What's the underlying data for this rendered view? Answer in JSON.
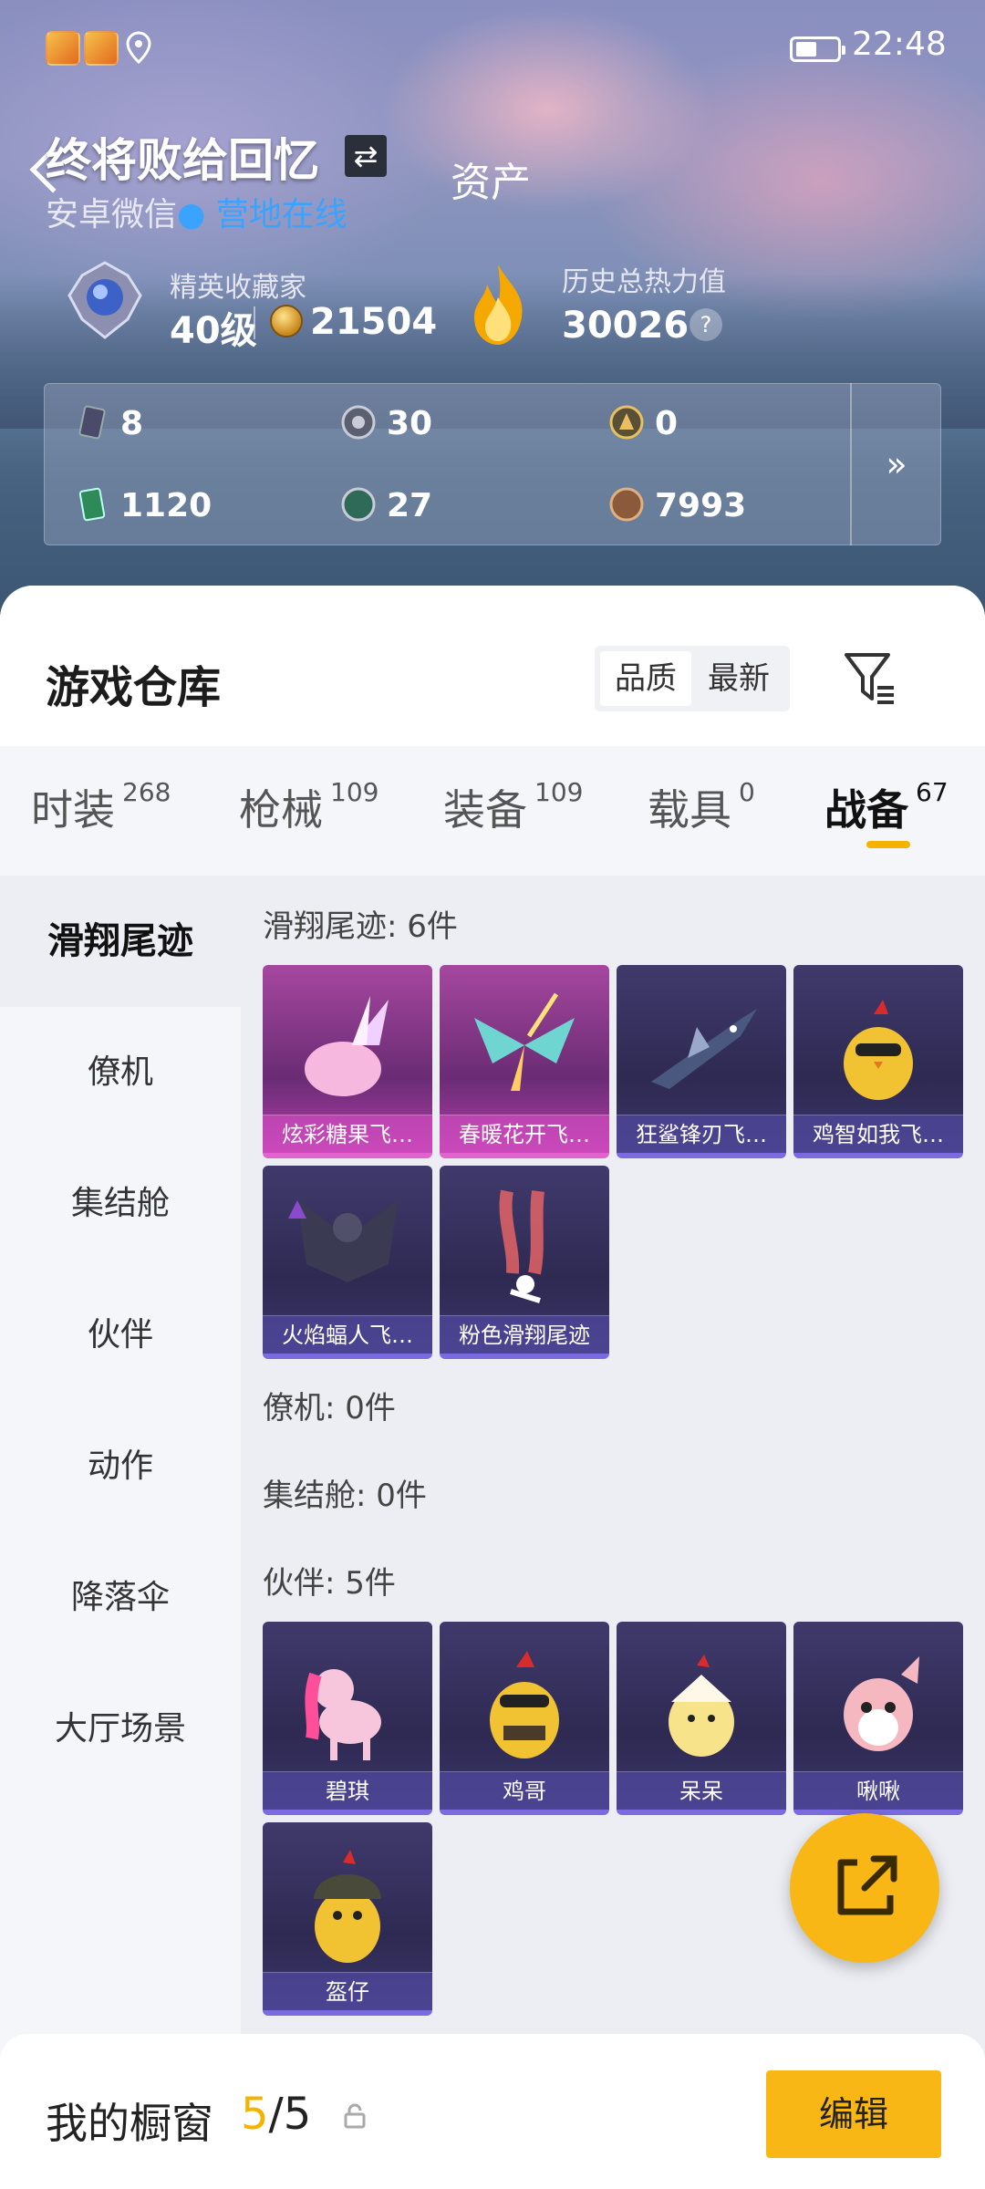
{
  "status": {
    "time": "22:48"
  },
  "header": {
    "username": "终将败给回忆",
    "swap_symbol": "⇄",
    "platform": "安卓微信",
    "online_status": "营地在线",
    "page_title": "资产",
    "rank_name": "精英收藏家",
    "level": "40级",
    "coins": "21504",
    "heat_label": "历史总热力值",
    "heat_value": "30026",
    "help_symbol": "?"
  },
  "resources": [
    {
      "icon": "card-icon",
      "value": "8"
    },
    {
      "icon": "silver-token-icon",
      "value": "30"
    },
    {
      "icon": "gold-token-icon",
      "value": "0"
    },
    {
      "icon": "green-card-icon",
      "value": "1120"
    },
    {
      "icon": "green-coin-icon",
      "value": "27"
    },
    {
      "icon": "bronze-coin-icon",
      "value": "7993"
    }
  ],
  "resources_more": "»",
  "warehouse": {
    "title": "游戏仓库",
    "sort_options": [
      "品质",
      "最新"
    ],
    "categories": [
      {
        "label": "时装",
        "count": "268"
      },
      {
        "label": "枪械",
        "count": "109"
      },
      {
        "label": "装备",
        "count": "109"
      },
      {
        "label": "载具",
        "count": "0"
      },
      {
        "label": "战备",
        "count": "67"
      }
    ],
    "side_items": [
      "滑翔尾迹",
      "僚机",
      "集结舱",
      "伙伴",
      "动作",
      "降落伞",
      "大厅场景"
    ],
    "sections": [
      {
        "title": "滑翔尾迹: 6件",
        "items": [
          "炫彩糖果飞…",
          "春暖花开飞…",
          "狂鲨锋刃飞…",
          "鸡智如我飞…",
          "火焰蝠人飞…",
          "粉色滑翔尾迹"
        ]
      },
      {
        "title": "僚机: 0件"
      },
      {
        "title": "集结舱: 0件"
      },
      {
        "title": "伙伴: 5件",
        "items": [
          "碧琪",
          "鸡哥",
          "呆呆",
          "啾啾",
          "盔仔"
        ]
      }
    ]
  },
  "bottom": {
    "label": "我的橱窗",
    "count_current": "5",
    "count_total": "/5",
    "edit_label": "编辑"
  },
  "colors": {
    "accent": "#f9b715",
    "online": "#3aa3ff",
    "rare_pink": "#e263cf",
    "epic_purple": "#7a6be0"
  }
}
